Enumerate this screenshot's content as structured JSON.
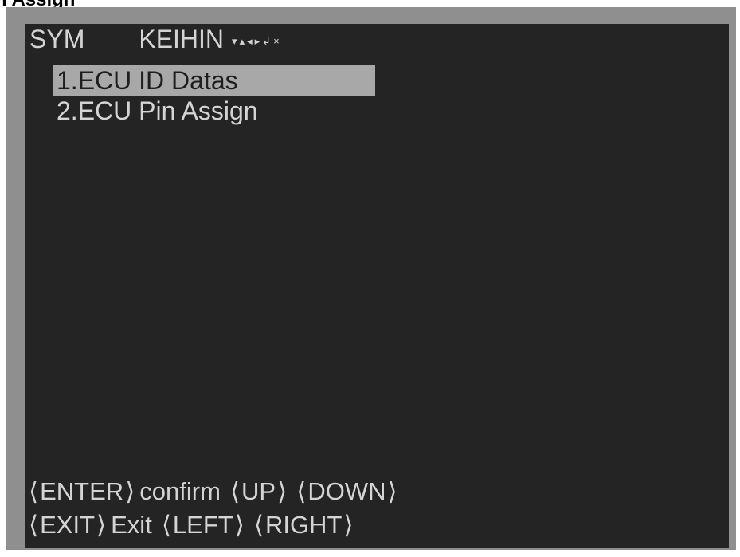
{
  "caption": "n Assign",
  "header": {
    "brand": "SYM",
    "maker": "KEIHIN",
    "nav_icons": [
      "▾",
      "▴",
      "◂",
      "▸",
      "↲",
      "×"
    ]
  },
  "menu": {
    "items": [
      {
        "label": "1.ECU ID Datas",
        "selected": true
      },
      {
        "label": "2.ECU Pin Assign",
        "selected": false
      }
    ]
  },
  "footer": {
    "row1": [
      {
        "key": "ENTER",
        "desc": "confirm"
      },
      {
        "key": "UP",
        "desc": ""
      },
      {
        "key": "DOWN",
        "desc": ""
      }
    ],
    "row2": [
      {
        "key": "EXIT",
        "desc": "Exit"
      },
      {
        "key": "LEFT",
        "desc": ""
      },
      {
        "key": "RIGHT",
        "desc": ""
      }
    ],
    "open_bracket": "⟨",
    "close_bracket": "⟩"
  },
  "colors": {
    "screen_bg": "#242424",
    "frame": "#8f8f8f",
    "text": "#d4d4d4",
    "highlight": "#a8a8a8"
  }
}
